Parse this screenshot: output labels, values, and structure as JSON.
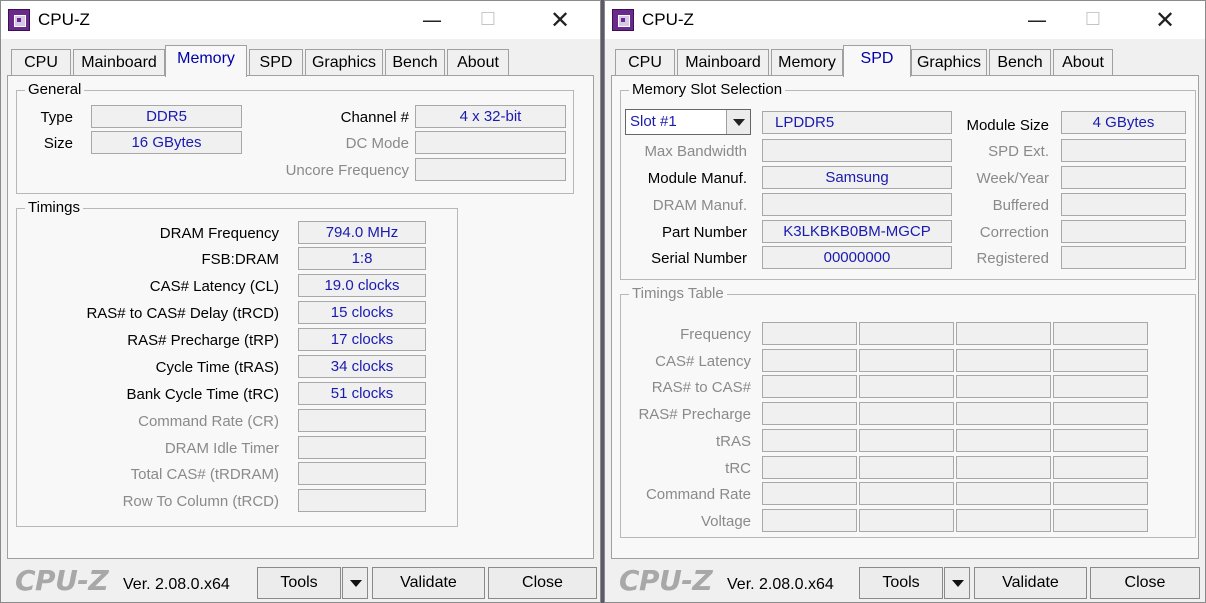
{
  "left": {
    "title": "CPU-Z",
    "tabs": [
      "CPU",
      "Mainboard",
      "Memory",
      "SPD",
      "Graphics",
      "Bench",
      "About"
    ],
    "active_tab": "Memory",
    "general": {
      "title": "General",
      "type_label": "Type",
      "type_value": "DDR5",
      "size_label": "Size",
      "size_value": "16 GBytes",
      "channel_label": "Channel #",
      "channel_value": "4 x 32-bit",
      "dc_mode_label": "DC Mode",
      "dc_mode_value": "",
      "uncore_label": "Uncore Frequency",
      "uncore_value": ""
    },
    "timings": {
      "title": "Timings",
      "rows": [
        {
          "label": "DRAM Frequency",
          "value": "794.0 MHz",
          "enabled": true
        },
        {
          "label": "FSB:DRAM",
          "value": "1:8",
          "enabled": true
        },
        {
          "label": "CAS# Latency (CL)",
          "value": "19.0 clocks",
          "enabled": true
        },
        {
          "label": "RAS# to CAS# Delay (tRCD)",
          "value": "15 clocks",
          "enabled": true
        },
        {
          "label": "RAS# Precharge (tRP)",
          "value": "17 clocks",
          "enabled": true
        },
        {
          "label": "Cycle Time (tRAS)",
          "value": "34 clocks",
          "enabled": true
        },
        {
          "label": "Bank Cycle Time (tRC)",
          "value": "51 clocks",
          "enabled": true
        },
        {
          "label": "Command Rate (CR)",
          "value": "",
          "enabled": false
        },
        {
          "label": "DRAM Idle Timer",
          "value": "",
          "enabled": false
        },
        {
          "label": "Total CAS# (tRDRAM)",
          "value": "",
          "enabled": false
        },
        {
          "label": "Row To Column (tRCD)",
          "value": "",
          "enabled": false
        }
      ]
    }
  },
  "right": {
    "title": "CPU-Z",
    "tabs": [
      "CPU",
      "Mainboard",
      "Memory",
      "SPD",
      "Graphics",
      "Bench",
      "About"
    ],
    "active_tab": "SPD",
    "slot_selection": {
      "title": "Memory Slot Selection",
      "slot_value": "Slot #1",
      "module_type": "LPDDR5",
      "module_size_label": "Module Size",
      "module_size_value": "4 GBytes",
      "left_rows": [
        {
          "label": "Max Bandwidth",
          "value": "",
          "enabled": false
        },
        {
          "label": "Module Manuf.",
          "value": "Samsung",
          "enabled": true
        },
        {
          "label": "DRAM Manuf.",
          "value": "",
          "enabled": false
        },
        {
          "label": "Part Number",
          "value": "K3LKBKB0BM-MGCP",
          "enabled": true
        },
        {
          "label": "Serial Number",
          "value": "00000000",
          "enabled": true
        }
      ],
      "right_rows": [
        {
          "label": "SPD Ext.",
          "value": ""
        },
        {
          "label": "Week/Year",
          "value": ""
        },
        {
          "label": "Buffered",
          "value": ""
        },
        {
          "label": "Correction",
          "value": ""
        },
        {
          "label": "Registered",
          "value": ""
        }
      ]
    },
    "timings_table": {
      "title": "Timings Table",
      "rows": [
        "Frequency",
        "CAS# Latency",
        "RAS# to CAS#",
        "RAS# Precharge",
        "tRAS",
        "tRC",
        "Command Rate",
        "Voltage"
      ]
    }
  },
  "footer": {
    "brand": "CPU-Z",
    "version": "Ver. 2.08.0.x64",
    "tools_label": "Tools",
    "validate_label": "Validate",
    "close_label": "Close"
  },
  "colors": {
    "value_text": "#1a1ab0",
    "active_tab_text": "#0000a8",
    "disabled_text": "#8a8a8a"
  }
}
